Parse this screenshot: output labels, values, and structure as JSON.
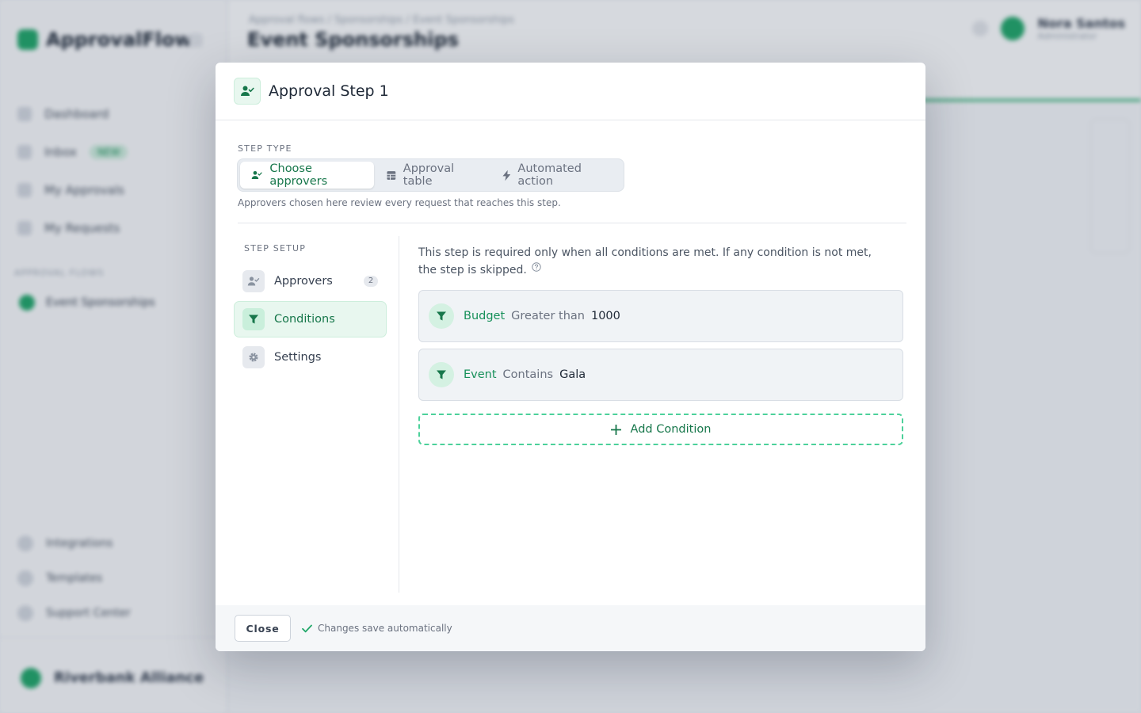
{
  "background": {
    "app_name": "ApprovalFlow",
    "nav": [
      "Dashboard",
      "Inbox",
      "My Approvals",
      "My Requests"
    ],
    "nav_badge": "NEW",
    "section_label": "APPROVAL FLOWS",
    "flow_item": "Event Sponsorships",
    "bottom_nav": [
      "Integrations",
      "Templates",
      "Support Center"
    ],
    "account_name": "Riverbank Alliance",
    "breadcrumb": "Approval flows  /  Sponsorships  /  Event Sponsorships",
    "page_title": "Event Sponsorships",
    "user_name": "Nora Santos",
    "user_role": "Administrator"
  },
  "modal": {
    "title": "Approval Step 1",
    "step_type_label": "STEP TYPE",
    "step_types": [
      {
        "label": "Choose approvers",
        "icon": "user-check-icon",
        "active": true
      },
      {
        "label": "Approval table",
        "icon": "table-icon",
        "active": false
      },
      {
        "label": "Automated action",
        "icon": "bolt-icon",
        "active": false
      }
    ],
    "step_hint": "Approvers chosen here review every request that reaches this step.",
    "setup_label": "STEP SETUP",
    "setup_nav": [
      {
        "label": "Approvers",
        "icon": "user-check-icon",
        "badge": "2",
        "active": false
      },
      {
        "label": "Conditions",
        "icon": "filter-icon",
        "active": true
      },
      {
        "label": "Settings",
        "icon": "gear-icon",
        "active": false
      }
    ],
    "conditions": {
      "description": "This step is required only when all conditions are met. If any condition is not met, the step is skipped.",
      "items": [
        {
          "field": "Budget",
          "operator": "Greater than",
          "value": "1000"
        },
        {
          "field": "Event",
          "operator": "Contains",
          "value": "Gala"
        }
      ],
      "add_label": "Add Condition"
    },
    "footer": {
      "close_label": "Close",
      "save_note": "Changes save automatically"
    }
  },
  "colors": {
    "accent": "#17774b",
    "accent_light": "#e8f7ef",
    "dashed_border": "#4cd19a",
    "overlay": "#1e2d46"
  }
}
